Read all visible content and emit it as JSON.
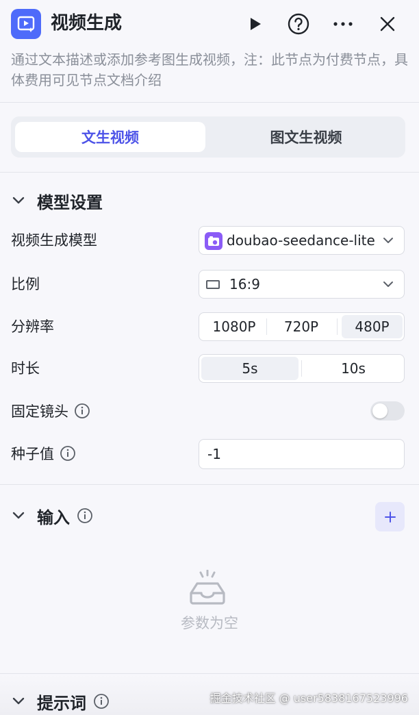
{
  "header": {
    "title": "视频生成",
    "description": "通过文本描述或添加参考图生成视频，注：此节点为付费节点，具体费用可见节点文档介绍",
    "icons": [
      "video-generate-icon",
      "play-icon",
      "help-icon",
      "more-icon",
      "close-icon"
    ]
  },
  "tabs": [
    {
      "label": "文生视频",
      "active": true
    },
    {
      "label": "图文生视频",
      "active": false
    }
  ],
  "model_settings": {
    "section_label": "模型设置",
    "model": {
      "label": "视频生成模型",
      "value": "doubao-seedance-lite"
    },
    "ratio": {
      "label": "比例",
      "value": "16:9"
    },
    "resolution": {
      "label": "分辨率",
      "options": [
        "1080P",
        "720P",
        "480P"
      ],
      "selected": "480P"
    },
    "duration": {
      "label": "时长",
      "options": [
        "5s",
        "10s"
      ],
      "selected": "5s"
    },
    "fixed_camera": {
      "label": "固定镜头",
      "on": false
    },
    "seed": {
      "label": "种子值",
      "value": "-1"
    }
  },
  "input_section": {
    "section_label": "输入",
    "empty_text": "参数为空"
  },
  "prompt_section": {
    "section_label": "提示词"
  },
  "watermark": "掘金技术社区 @ user5838167523996",
  "colors": {
    "accent": "#4d53e8",
    "app_icon": "#4e6bfa",
    "model_icon": "#8b5cf6"
  }
}
